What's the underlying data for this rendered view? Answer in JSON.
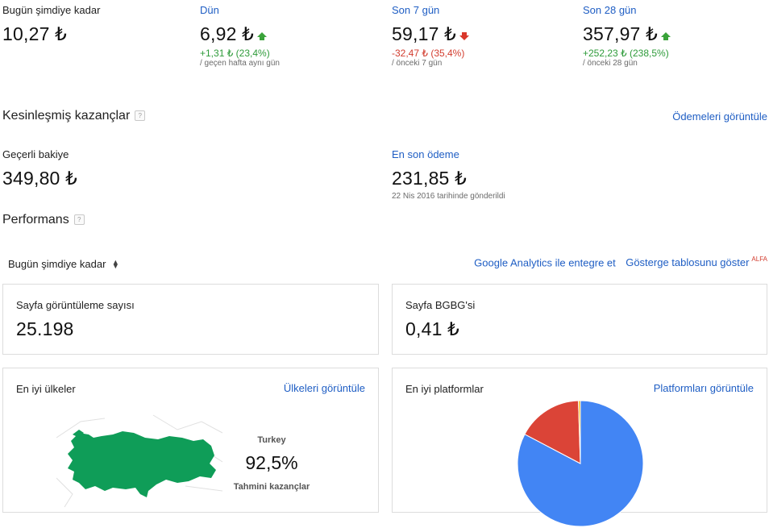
{
  "summary": [
    {
      "label": "Bugün şimdiye kadar",
      "value": "10,27 ₺",
      "change": "",
      "compare": "",
      "trend": "none"
    },
    {
      "label": "Dün",
      "value": "6,92 ₺",
      "change": "+1,31 ₺ (23,4%)",
      "compare": "/ geçen hafta aynı gün",
      "trend": "up"
    },
    {
      "label": "Son 7 gün",
      "value": "59,17 ₺",
      "change": "-32,47 ₺ (35,4%)",
      "compare": "/ önceki 7 gün",
      "trend": "down"
    },
    {
      "label": "Son 28 gün",
      "value": "357,97 ₺",
      "change": "+252,23 ₺ (238,5%)",
      "compare": "/ önceki 28 gün",
      "trend": "up"
    }
  ],
  "finalized": {
    "title": "Kesinleşmiş kazançlar",
    "help": "?",
    "view_payments": "Ödemeleri görüntüle",
    "balance_label": "Geçerli bakiye",
    "balance_value": "349,80 ₺",
    "last_payment_label": "En son ödeme",
    "last_payment_value": "231,85 ₺",
    "last_payment_note": "22 Nis 2016 tarihinde gönderildi"
  },
  "performance": {
    "title": "Performans",
    "help": "?",
    "range_select": "Bugün şimdiye kadar",
    "analytics_link": "Google Analytics ile entegre et",
    "dashboard_link": "Gösterge tablosunu göster",
    "alfa": "ALFA"
  },
  "metrics": [
    {
      "label": "Sayfa görüntüleme sayısı",
      "value": "25.198"
    },
    {
      "label": "Sayfa BGBG'si",
      "value": "0,41 ₺"
    }
  ],
  "countries": {
    "title": "En iyi ülkeler",
    "link": "Ülkeleri görüntüle",
    "country": "Turkey",
    "percent": "92,5%",
    "caption": "Tahmini kazançlar"
  },
  "platforms": {
    "title": "En iyi platformlar",
    "link": "Platformları görüntüle"
  },
  "chart_data": {
    "type": "pie",
    "values": [
      82.7,
      16.8,
      0.5
    ],
    "colors": [
      "#4285f4",
      "#db4437",
      "#f4b400"
    ]
  },
  "colors": {
    "link": "#1f5ec4",
    "positive": "#2e9b3a",
    "negative": "#d23c2e",
    "map": "#0f9d58"
  }
}
